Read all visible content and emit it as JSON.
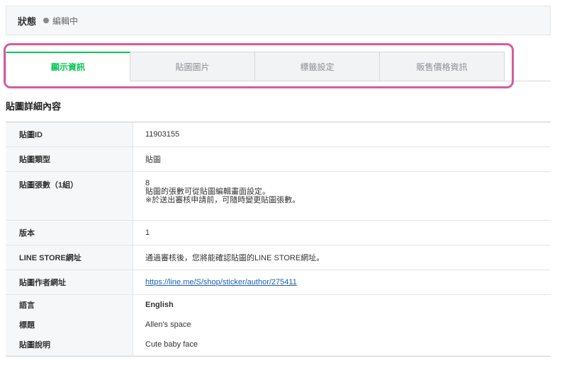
{
  "status": {
    "label": "狀態",
    "value": "編輯中"
  },
  "tabs": [
    {
      "label": "顯示資訊",
      "active": true
    },
    {
      "label": "貼圖圖片",
      "active": false
    },
    {
      "label": "標籤設定",
      "active": false
    },
    {
      "label": "販售價格資訊",
      "active": false
    }
  ],
  "section": {
    "title": "貼圖詳細內容"
  },
  "details": {
    "sticker_id_label": "貼圖ID",
    "sticker_id_value": "11903155",
    "type_label": "貼圖類型",
    "type_value": "貼圖",
    "count_label": "貼圖張數（1組）",
    "count_value": "8",
    "count_note_1": "貼圖的張數可從貼圖編輯畫面設定。",
    "count_note_2": "※於送出審核申請前，可隨時變更貼圖張數。",
    "version_label": "版本",
    "version_value": "1",
    "store_label": "LINE STORE網址",
    "store_value": "通過審核後，您將能確認貼圖的LINE STORE網址。",
    "author_label": "貼圖作者網址",
    "author_value": "https://line.me/S/shop/sticker/author/275411",
    "language_label": "語言",
    "language_value": "English",
    "title_label": "標題",
    "title_value": "Allen's space",
    "description_label": "貼圖說明",
    "description_value": "Cute baby face"
  },
  "colors": {
    "accent": "#06c755",
    "highlight": "#d55ba1",
    "link": "#1a5fb4"
  }
}
